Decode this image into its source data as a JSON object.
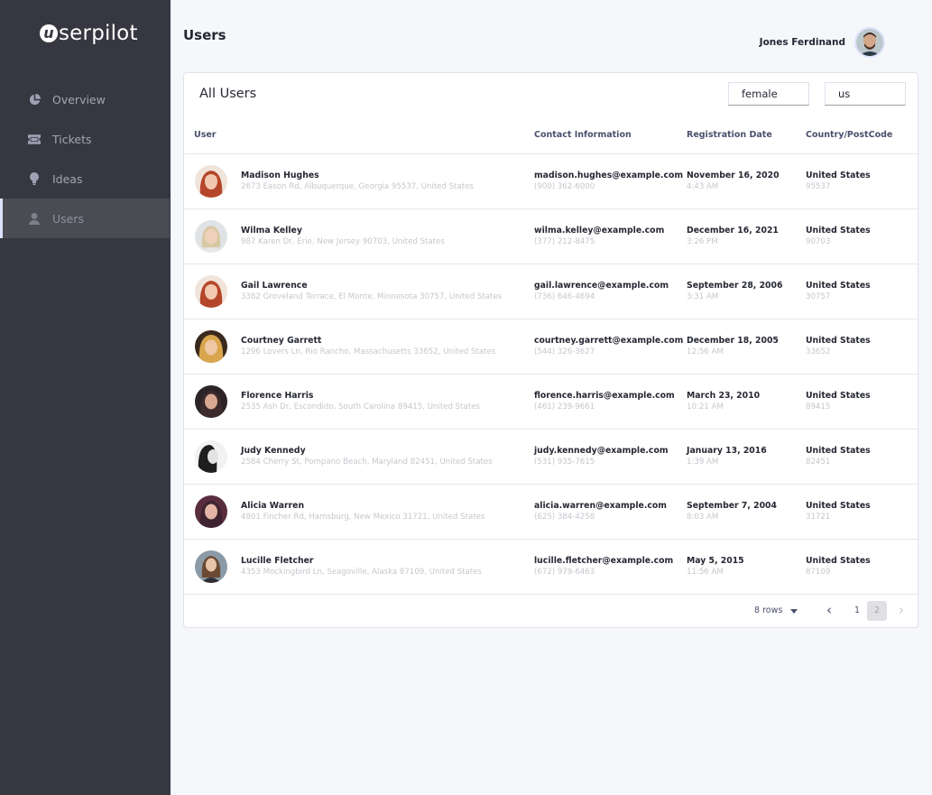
{
  "sidebar": {
    "logo_mark": "u",
    "logo_text": "serpilot",
    "items": [
      {
        "label": "Overview",
        "icon": "pie-chart-icon"
      },
      {
        "label": "Tickets",
        "icon": "ticket-icon"
      },
      {
        "label": "Ideas",
        "icon": "lightbulb-icon"
      },
      {
        "label": "Users",
        "icon": "user-icon",
        "active": true
      }
    ]
  },
  "header": {
    "title": "Users",
    "user_name": "Jones Ferdinand"
  },
  "card": {
    "title": "All Users",
    "filters": {
      "gender": "female",
      "country": "us"
    },
    "columns": [
      "User",
      "Contact Information",
      "Registration Date",
      "Country/PostCode"
    ],
    "rows": [
      {
        "name": "Madison Hughes",
        "address": "2673 Eason Rd, Albuquerque, Georgia 95537, United States",
        "email": "madison.hughes@example.com",
        "phone": "(900) 362-6000",
        "date": "November 16, 2020",
        "time": "4:43 AM",
        "country": "United States",
        "postcode": "95537"
      },
      {
        "name": "Wilma Kelley",
        "address": "987 Karen Dr, Erie, New Jersey 90703, United States",
        "email": "wilma.kelley@example.com",
        "phone": "(377) 212-8475",
        "date": "December 16, 2021",
        "time": "3:26 PM",
        "country": "United States",
        "postcode": "90703"
      },
      {
        "name": "Gail Lawrence",
        "address": "3382 Groveland Terrace, El Monte, Minnesota 30757, United States",
        "email": "gail.lawrence@example.com",
        "phone": "(736) 646-4694",
        "date": "September 28, 2006",
        "time": "3:31 AM",
        "country": "United States",
        "postcode": "30757"
      },
      {
        "name": "Courtney Garrett",
        "address": "1296 Lovers Ln, Rio Rancho, Massachusetts 33652, United States",
        "email": "courtney.garrett@example.com",
        "phone": "(544) 326-3627",
        "date": "December 18, 2005",
        "time": "12:56 AM",
        "country": "United States",
        "postcode": "33652"
      },
      {
        "name": "Florence Harris",
        "address": "2535 Ash Dr, Escondido, South Carolina 89415, United States",
        "email": "florence.harris@example.com",
        "phone": "(461) 239-9661",
        "date": "March 23, 2010",
        "time": "10:21 AM",
        "country": "United States",
        "postcode": "89415"
      },
      {
        "name": "Judy Kennedy",
        "address": "2584 Cherry St, Pompano Beach, Maryland 82451, United States",
        "email": "judy.kennedy@example.com",
        "phone": "(531) 935-7615",
        "date": "January 13, 2016",
        "time": "1:39 AM",
        "country": "United States",
        "postcode": "82451"
      },
      {
        "name": "Alicia Warren",
        "address": "4801 Fincher Rd, Hamsburg, New Mexico 31721, United States",
        "email": "alicia.warren@example.com",
        "phone": "(625) 384-4258",
        "date": "September 7, 2004",
        "time": "8:03 AM",
        "country": "United States",
        "postcode": "31721"
      },
      {
        "name": "Lucille Fletcher",
        "address": "4353 Mockingbird Ln, Seagoville, Alaska 87109, United States",
        "email": "lucille.fletcher@example.com",
        "phone": "(672) 979-6463",
        "date": "May 5, 2015",
        "time": "11:56 AM",
        "country": "United States",
        "postcode": "87109"
      }
    ]
  },
  "pagination": {
    "rows_label": "8 rows",
    "pages": [
      "1",
      "2"
    ],
    "current_page": "2"
  },
  "colors": {
    "sidebar_bg": "#363740",
    "page_bg": "#f6f7fb",
    "active_item_bg": "#4a4b53"
  }
}
